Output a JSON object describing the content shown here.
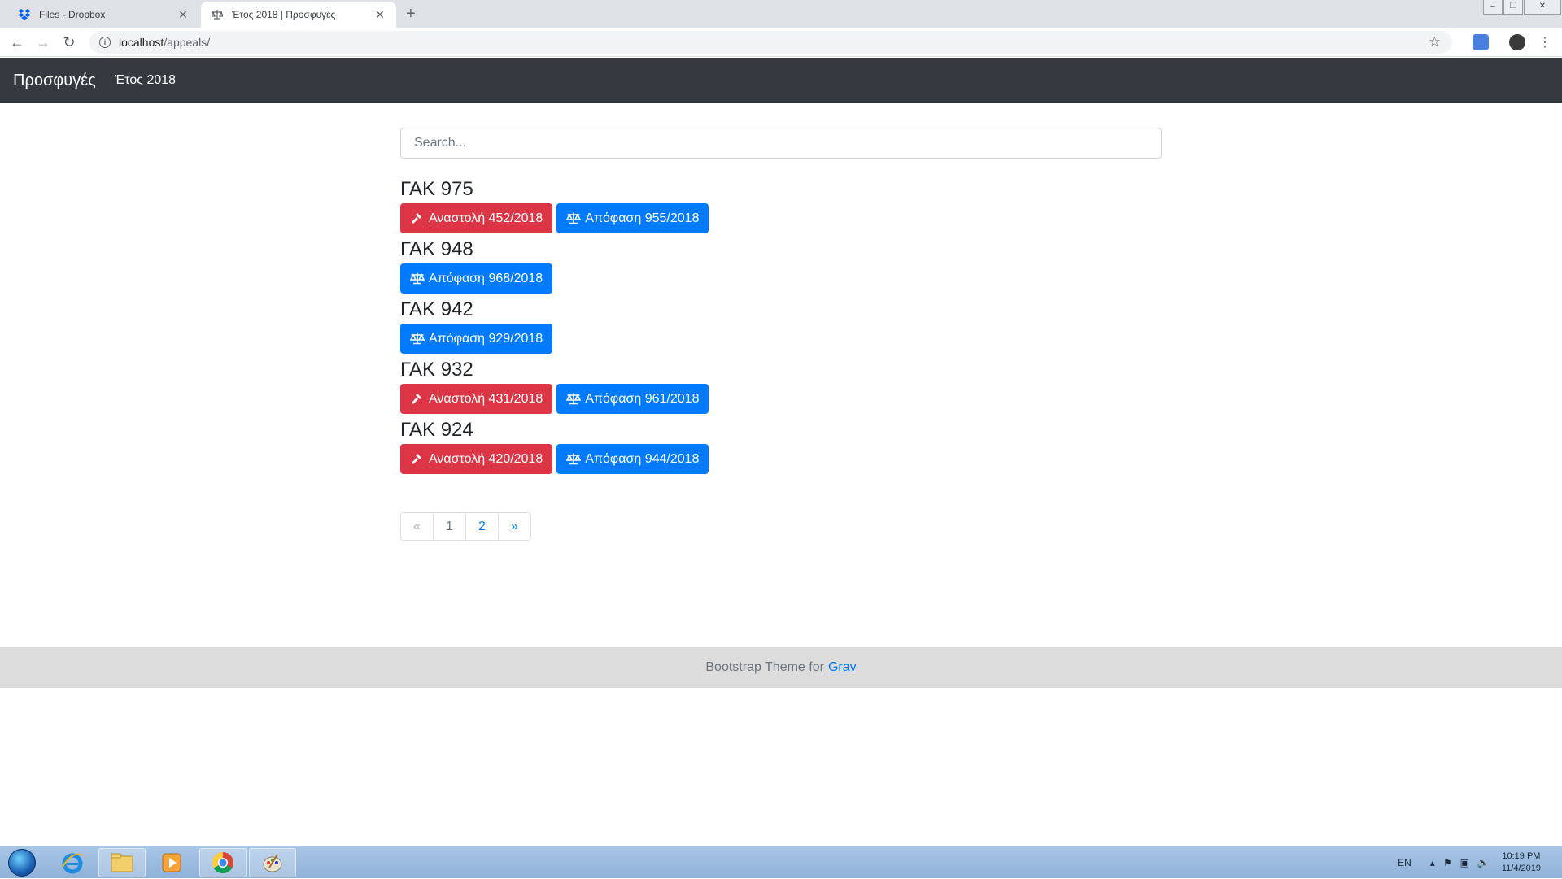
{
  "browser": {
    "tabs": [
      {
        "title": "Files - Dropbox",
        "icon": "dropbox-icon",
        "active": false
      },
      {
        "title": "Έτος 2018 | Προσφυγές",
        "icon": "scale-icon",
        "active": true
      }
    ],
    "new_tab_symbol": "+",
    "url_host": "localhost",
    "url_path": "/appeals/"
  },
  "navbar": {
    "brand": "Προσφυγές",
    "link": "Έτος 2018"
  },
  "search": {
    "placeholder": "Search..."
  },
  "appeals": [
    {
      "title": "ΓΑΚ 975",
      "buttons": [
        {
          "type": "suspension",
          "label": "Αναστολή 452/2018"
        },
        {
          "type": "decision",
          "label": "Απόφαση 955/2018"
        }
      ]
    },
    {
      "title": "ΓΑΚ 948",
      "buttons": [
        {
          "type": "decision",
          "label": "Απόφαση 968/2018"
        }
      ]
    },
    {
      "title": "ΓΑΚ 942",
      "buttons": [
        {
          "type": "decision",
          "label": "Απόφαση 929/2018"
        }
      ]
    },
    {
      "title": "ΓΑΚ 932",
      "buttons": [
        {
          "type": "suspension",
          "label": "Αναστολή 431/2018"
        },
        {
          "type": "decision",
          "label": "Απόφαση 961/2018"
        }
      ]
    },
    {
      "title": "ΓΑΚ 924",
      "buttons": [
        {
          "type": "suspension",
          "label": "Αναστολή 420/2018"
        },
        {
          "type": "decision",
          "label": "Απόφαση 944/2018"
        }
      ]
    }
  ],
  "pagination": {
    "prev": "«",
    "pages": [
      "1",
      "2"
    ],
    "current": "1",
    "next": "»"
  },
  "footer": {
    "text": "Bootstrap Theme for",
    "link": "Grav"
  },
  "taskbar": {
    "language": "EN",
    "time": "10:19 PM",
    "date": "11/4/2019"
  },
  "colors": {
    "navbar_bg": "#343a40",
    "suspension_button": "#dc3545",
    "decision_button": "#007bff",
    "footer_bg": "#dcdcdc",
    "link": "#007bff"
  }
}
